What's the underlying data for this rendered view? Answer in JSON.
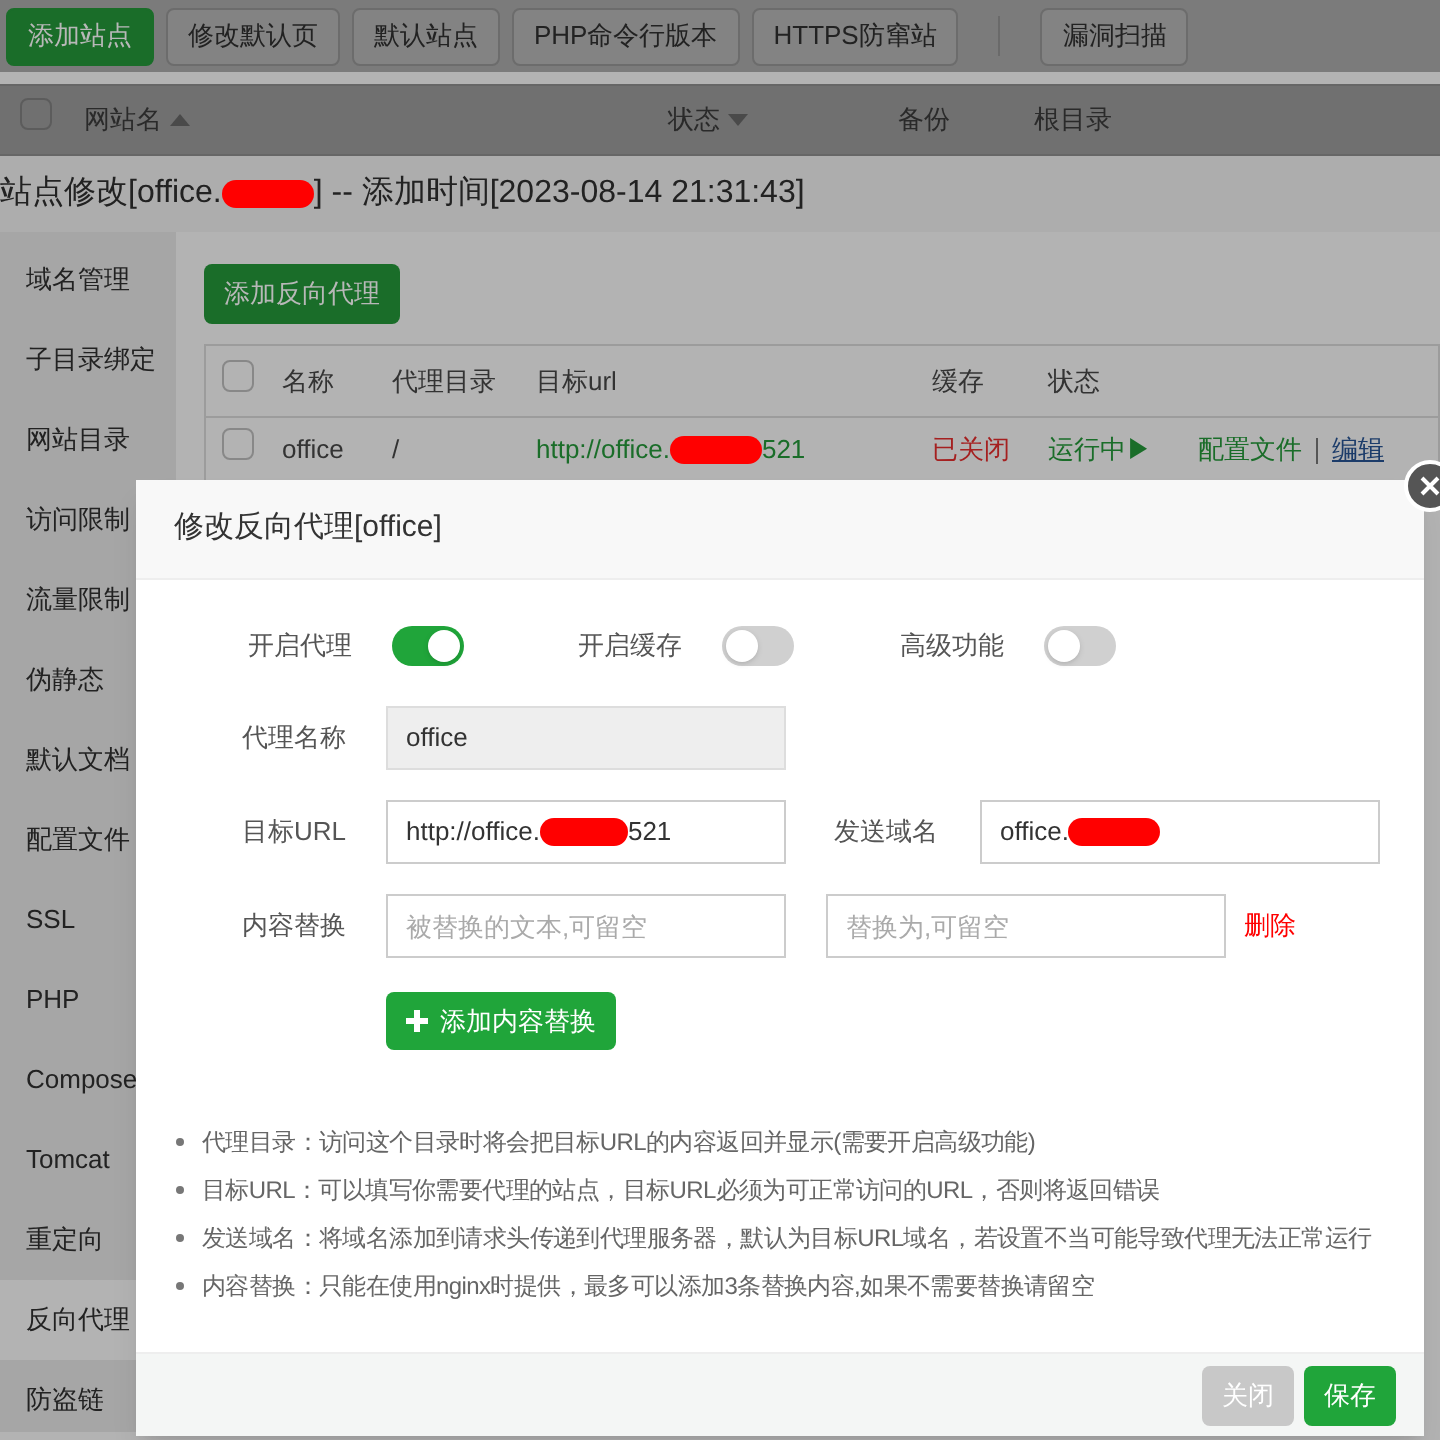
{
  "toolbar": {
    "groups": [
      [
        {
          "label": "添加站点",
          "kind": "primary"
        },
        {
          "label": "修改默认页",
          "kind": "default"
        },
        {
          "label": "默认站点",
          "kind": "default"
        },
        {
          "label": "PHP命令行版本",
          "kind": "default"
        },
        {
          "label": "HTTPS防窜站",
          "kind": "default"
        }
      ],
      [
        {
          "label": "漏洞扫描",
          "kind": "default"
        }
      ]
    ]
  },
  "sites_table": {
    "checked": false,
    "columns": [
      {
        "label": "网站名",
        "sortable": true,
        "descending": false
      },
      {
        "label": "状态",
        "sortable": true,
        "descending": true
      },
      {
        "label": "备份",
        "sortable": false
      },
      {
        "label": "根目录",
        "sortable": false
      }
    ]
  },
  "site_editor": {
    "title_prefix": "站点修改[office.",
    "title_redacted": true,
    "title_suffix": "] -- 添加时间[2023-08-14 21:31:43]",
    "sidebar": [
      {
        "label": "域名管理",
        "selected": false
      },
      {
        "label": "子目录绑定",
        "selected": false
      },
      {
        "label": "网站目录",
        "selected": false
      },
      {
        "label": "访问限制",
        "selected": false
      },
      {
        "label": "流量限制",
        "selected": false
      },
      {
        "label": "伪静态",
        "selected": false
      },
      {
        "label": "默认文档",
        "selected": false
      },
      {
        "label": "配置文件",
        "selected": false
      },
      {
        "label": "SSL",
        "selected": false
      },
      {
        "label": "PHP",
        "selected": false
      },
      {
        "label": "Compose",
        "selected": false
      },
      {
        "label": "Tomcat",
        "selected": false
      },
      {
        "label": "重定向",
        "selected": false
      },
      {
        "label": "反向代理",
        "selected": true
      },
      {
        "label": "防盗链",
        "selected": false
      }
    ],
    "add_button": "添加反向代理",
    "proxy_table": {
      "checked": false,
      "columns": [
        "名称",
        "代理目录",
        "目标url",
        "缓存",
        "状态"
      ],
      "rows": [
        {
          "checked": false,
          "name": "office",
          "dir": "/",
          "url_prefix": "http://office.",
          "url_redacted": true,
          "url_suffix": "521",
          "cache": "已关闭",
          "cache_on": false,
          "status": "运行中▶",
          "running": true,
          "actions": [
            "配置文件",
            "编辑"
          ]
        }
      ]
    }
  },
  "dialog": {
    "title": "修改反向代理[office]",
    "switches": [
      {
        "label": "开启代理",
        "on": true
      },
      {
        "label": "开启缓存",
        "on": false
      },
      {
        "label": "高级功能",
        "on": false
      }
    ],
    "proxy_name": {
      "label": "代理名称",
      "value": "office"
    },
    "target_url": {
      "label": "目标URL",
      "prefix": "http://office.",
      "redacted": true,
      "suffix": "521"
    },
    "send_domain": {
      "label": "发送域名",
      "prefix": "office.",
      "redacted": true
    },
    "replace": {
      "label": "内容替换",
      "from_placeholder": "被替换的文本,可留空",
      "to_placeholder": "替换为,可留空",
      "delete": "删除"
    },
    "add_replace": "添加内容替换",
    "hints": [
      "代理目录：访问这个目录时将会把目标URL的内容返回并显示(需要开启高级功能)",
      "目标URL：可以填写你需要代理的站点，目标URL必须为可正常访问的URL，否则将返回错误",
      "发送域名：将域名添加到请求头传递到代理服务器，默认为目标URL域名，若设置不当可能导致代理无法正常运行",
      "内容替换：只能在使用nginx时提供，最多可以添加3条替换内容,如果不需要替换请留空"
    ],
    "buttons": [
      {
        "label": "关闭",
        "kind": "secondary"
      },
      {
        "label": "保存",
        "kind": "primary"
      }
    ]
  }
}
